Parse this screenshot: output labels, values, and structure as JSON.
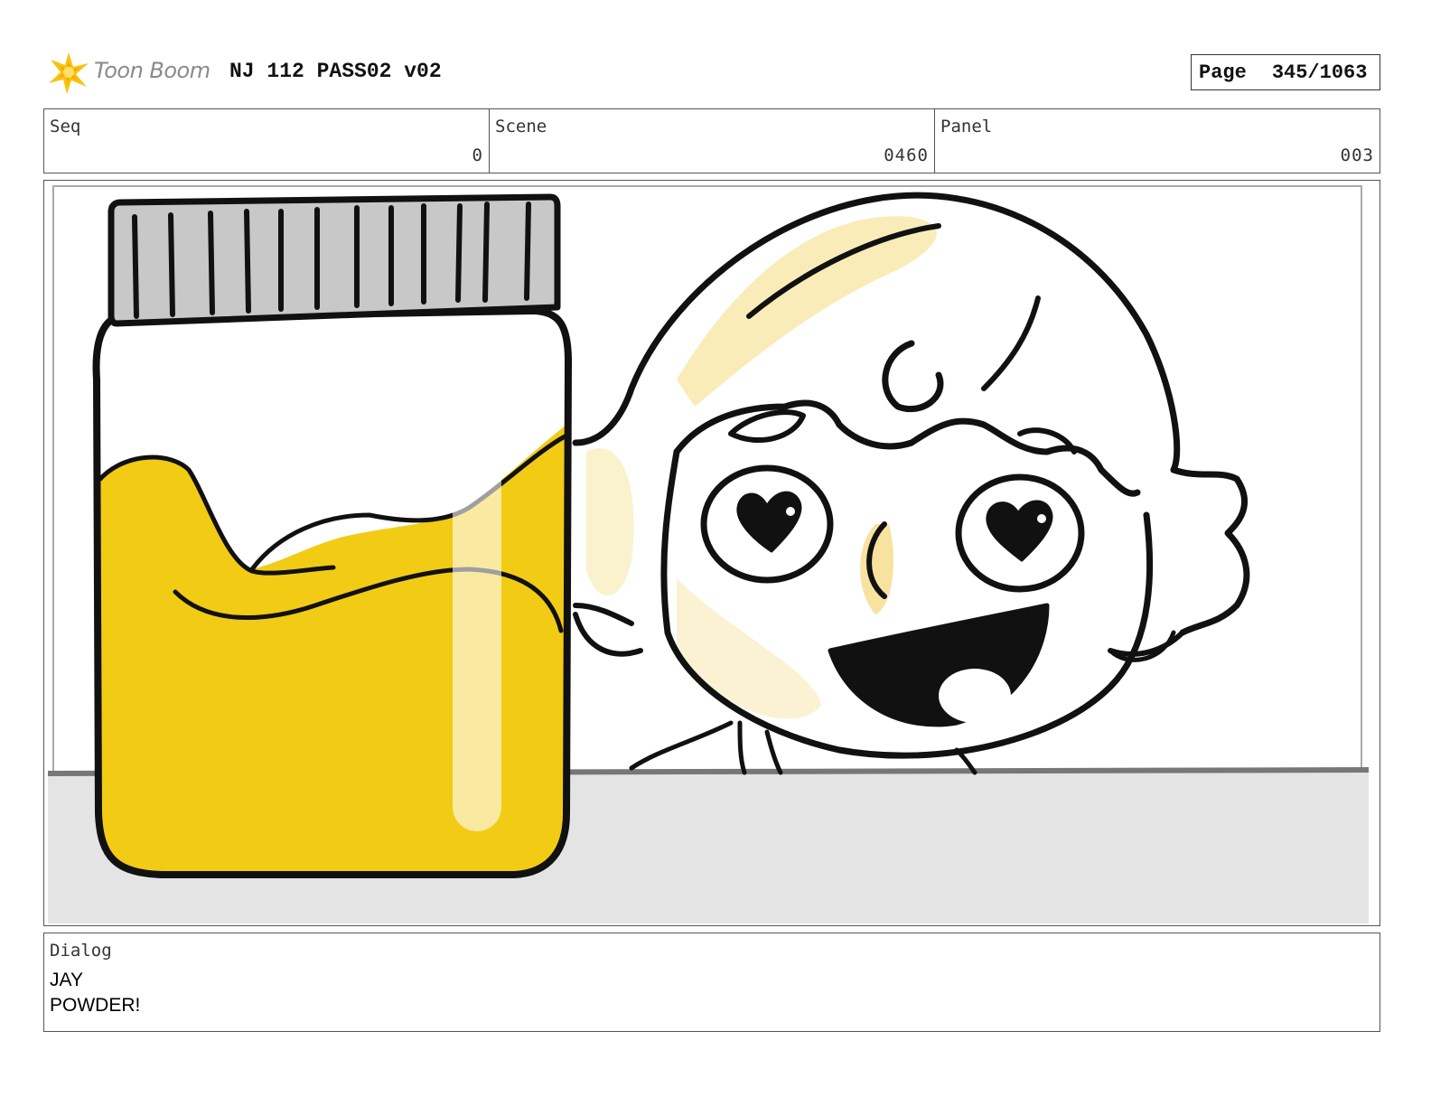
{
  "header": {
    "logo_text": "Toon Boom",
    "project_title": "NJ 112 PASS02 v02",
    "page_label": "Page",
    "page_value": "345/1063"
  },
  "info": {
    "seq_label": "Seq",
    "seq_value": "0",
    "scene_label": "Scene",
    "scene_value": "0460",
    "panel_label": "Panel",
    "panel_value": "003"
  },
  "dialog": {
    "label": "Dialog",
    "lines": [
      "JAY",
      "POWDER!"
    ]
  },
  "colors": {
    "accent_yellow": "#f2cb14",
    "cap_gray": "#c8c8c8",
    "table_gray": "#e4e4e4"
  },
  "icons": {
    "logo": "toon-boom-burst-icon"
  }
}
